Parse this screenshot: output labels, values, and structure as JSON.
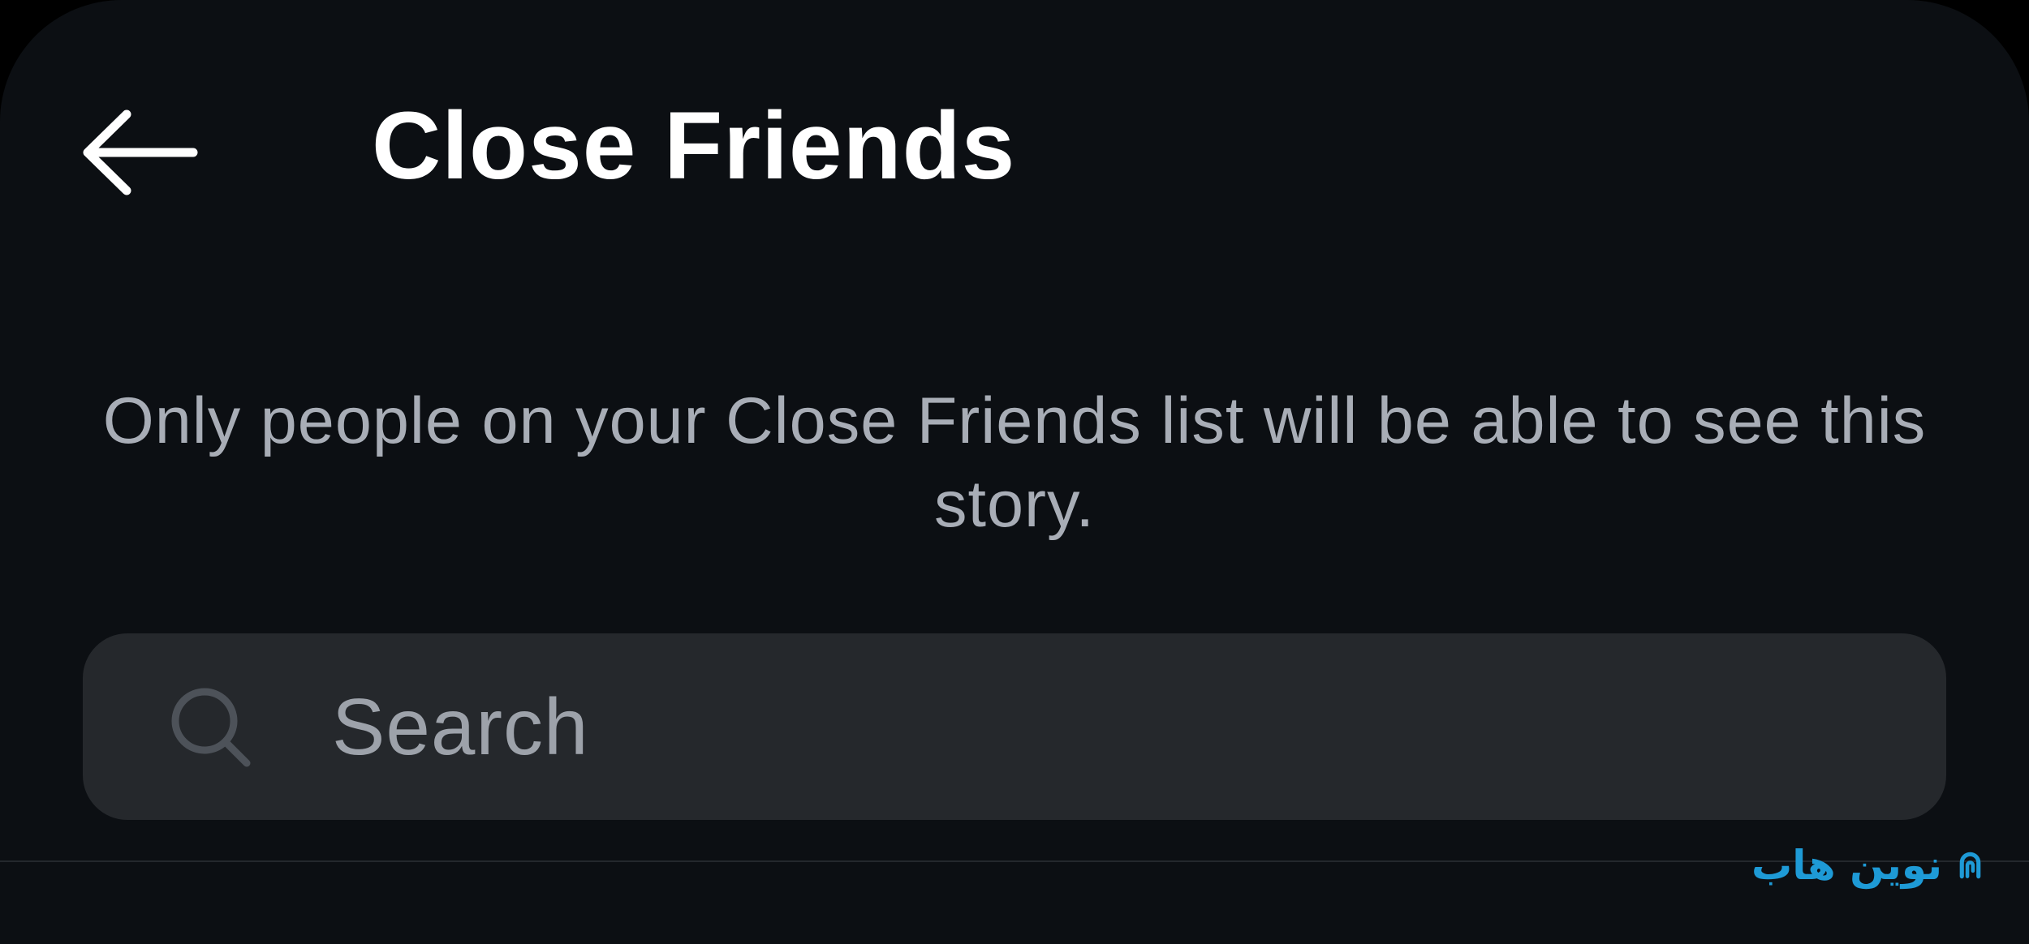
{
  "header": {
    "back_icon": "arrow-left-icon",
    "title": "Close Friends"
  },
  "description": "Only people on your Close Friends list will be able to see this story.",
  "search": {
    "icon": "search-icon",
    "placeholder": "Search",
    "value": ""
  },
  "watermark": {
    "logo_icon": "novinhub-logo-icon",
    "text": "نوین هاب"
  },
  "colors": {
    "background": "#0c0f13",
    "title": "#ffffff",
    "description": "#a8adb6",
    "search_background": "#25282c",
    "search_placeholder": "#9da2aa",
    "watermark": "#1e9ad6"
  }
}
